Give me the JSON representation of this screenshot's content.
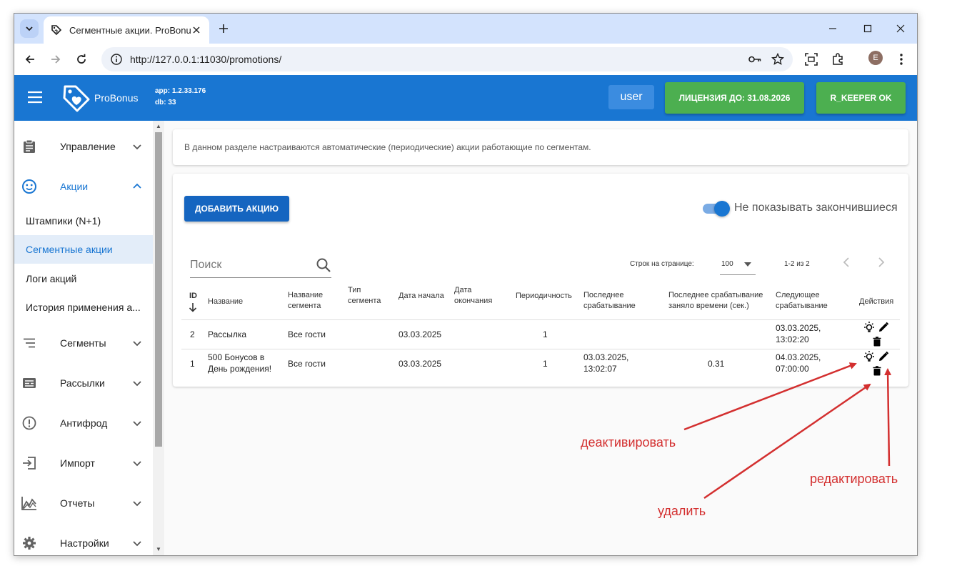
{
  "browser": {
    "tab_title": "Сегментные акции. ProBonus",
    "url": "http://127.0.0.1:11030/promotions/",
    "profile_initial": "E"
  },
  "app": {
    "brand": "ProBonus",
    "app_version": "app: 1.2.33.176",
    "db_version": "db: 33",
    "user_label": "user",
    "license_label": "ЛИЦЕНЗИЯ ДО: 31.08.2026",
    "rkeeper_label": "R_KEEPER OK",
    "colors": {
      "primary": "#1976d2",
      "success": "#4caf50",
      "annotation": "#d32f2f"
    }
  },
  "sidebar": {
    "items": [
      {
        "label": "Управление",
        "icon": "clipboard-icon"
      },
      {
        "label": "Акции",
        "icon": "smile-icon"
      },
      {
        "label": "Сегменты",
        "icon": "segments-icon"
      },
      {
        "label": "Рассылки",
        "icon": "mail-icon"
      },
      {
        "label": "Антифрод",
        "icon": "alert-icon"
      },
      {
        "label": "Импорт",
        "icon": "import-icon"
      },
      {
        "label": "Отчеты",
        "icon": "chart-icon"
      },
      {
        "label": "Настройки",
        "icon": "gear-icon"
      }
    ],
    "sub_items": [
      "Штампики (N+1)",
      "Сегментные акции",
      "Логи акций",
      "История применения а..."
    ]
  },
  "content": {
    "info_text": "В данном разделе настраиваются автоматические (периодические) акции работающие по сегментам.",
    "add_button": "ДОБАВИТЬ АКЦИЮ",
    "switch_label": "Не показывать закончившиеся",
    "switch_on": true,
    "search_placeholder": "Поиск",
    "rows_per_page_label": "Строк на странице:",
    "rows_per_page": "100",
    "page_range": "1-2 из 2"
  },
  "table": {
    "headers": [
      "ID",
      "Название",
      "Название сегмента",
      "Тип сегмента",
      "Дата начала",
      "Дата окончания",
      "Периодичность",
      "Последнее срабатывание",
      "Последнее срабатывание заняло времени (сек.)",
      "Следующее срабатывание",
      "Действия"
    ],
    "rows": [
      {
        "id": "2",
        "name": "Рассылка",
        "segment": "Все гости",
        "segment_type": "",
        "start": "03.03.2025",
        "end": "",
        "period": "1",
        "last_run": "",
        "last_duration": "",
        "next_run": "03.03.2025, 13:02:20"
      },
      {
        "id": "1",
        "name": "500 Бонусов в День рождения!",
        "segment": "Все гости",
        "segment_type": "",
        "start": "03.03.2025",
        "end": "",
        "period": "1",
        "last_run": "03.03.2025, 13:02:07",
        "last_duration": "0.31",
        "next_run": "04.03.2025, 07:00:00"
      }
    ]
  },
  "annotations": {
    "deactivate": "деактивировать",
    "edit": "редактировать",
    "delete": "удалить"
  }
}
